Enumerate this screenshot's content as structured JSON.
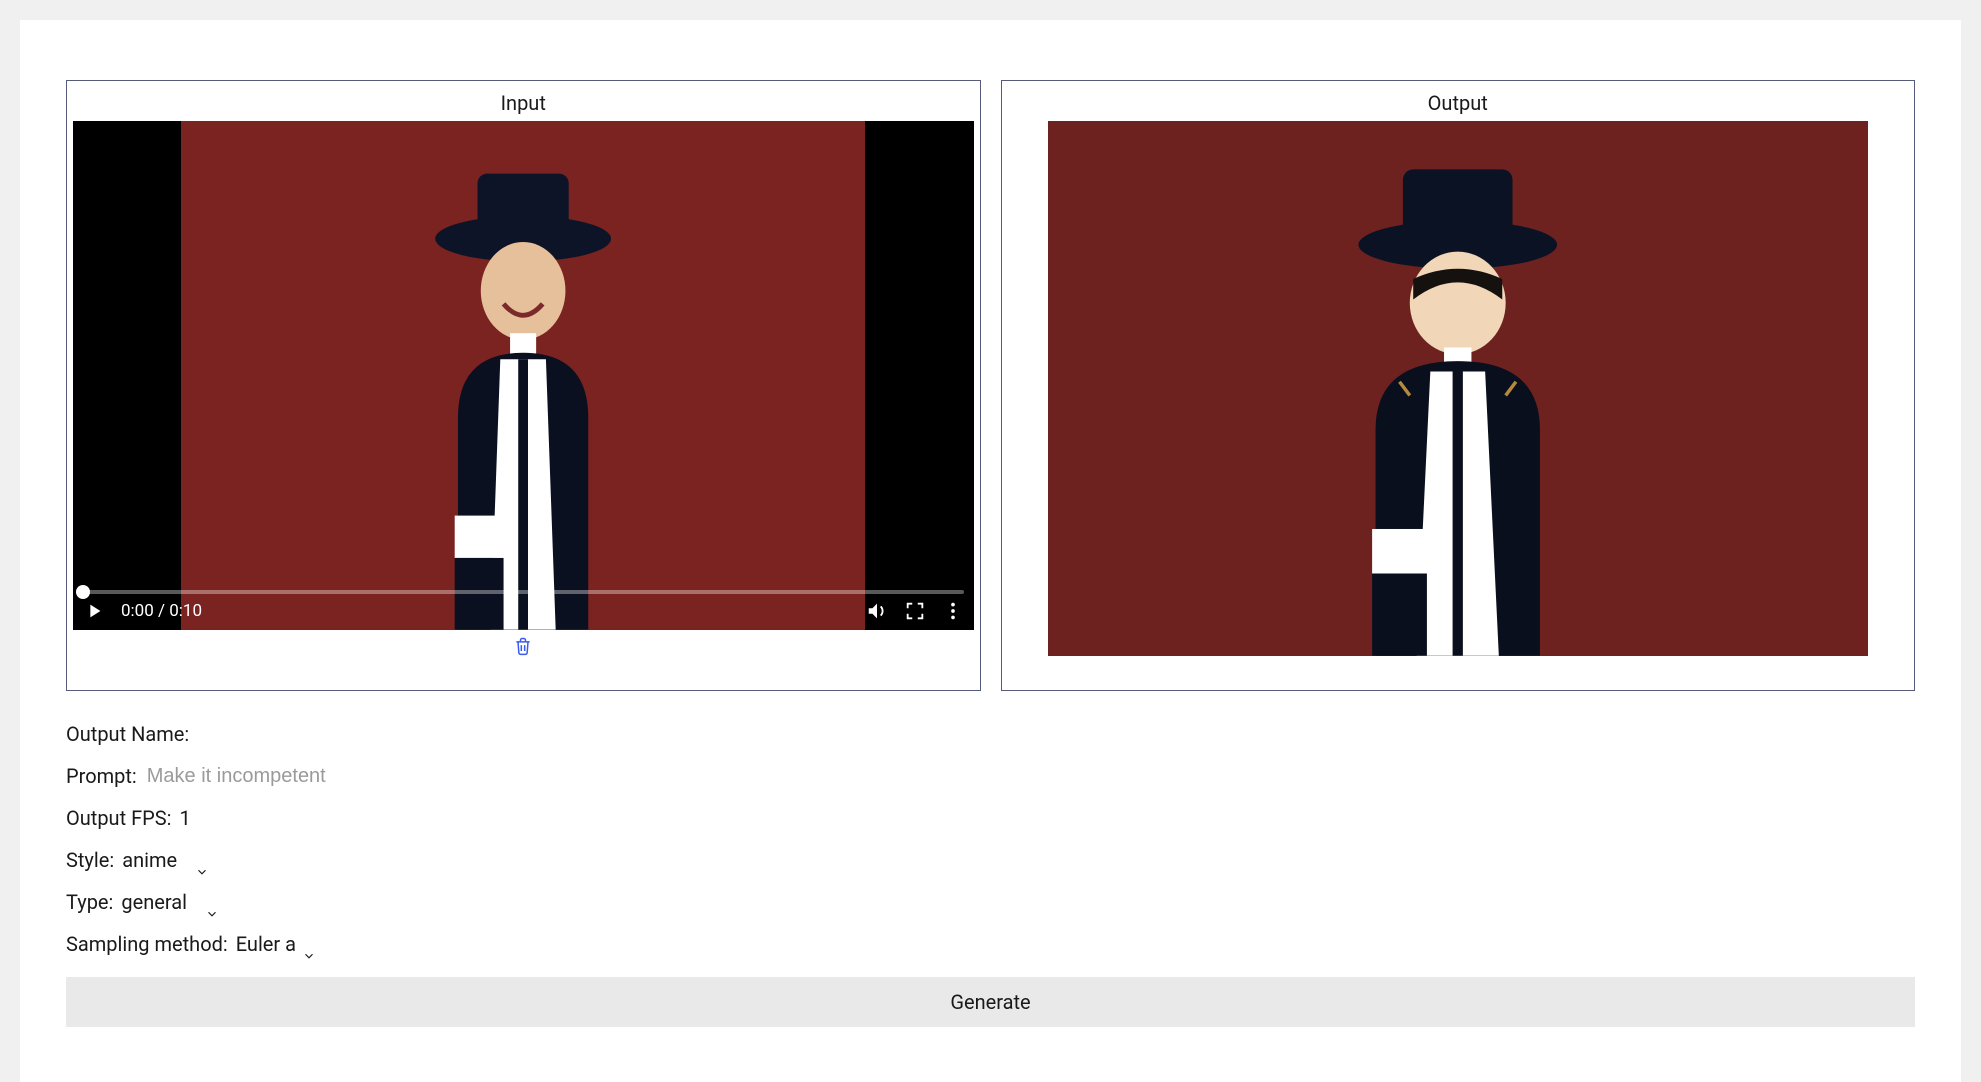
{
  "panels": {
    "input_title": "Input",
    "output_title": "Output"
  },
  "video": {
    "time_text": "0:00 / 0:10",
    "progress_percent": 0
  },
  "form": {
    "output_name_label": "Output Name:",
    "output_name_value": "",
    "prompt_label": "Prompt:",
    "prompt_placeholder": "Make it incompetent",
    "prompt_value": "",
    "fps_label": "Output FPS:",
    "fps_value": "1",
    "style_label": "Style:",
    "style_value": "anime",
    "type_label": "Type:",
    "type_value": "general",
    "sampling_label": "Sampling method:",
    "sampling_value": "Euler a"
  },
  "buttons": {
    "generate_label": "Generate"
  },
  "colors": {
    "panel_border": "#555b78",
    "stage_bg": "#7a2320"
  }
}
